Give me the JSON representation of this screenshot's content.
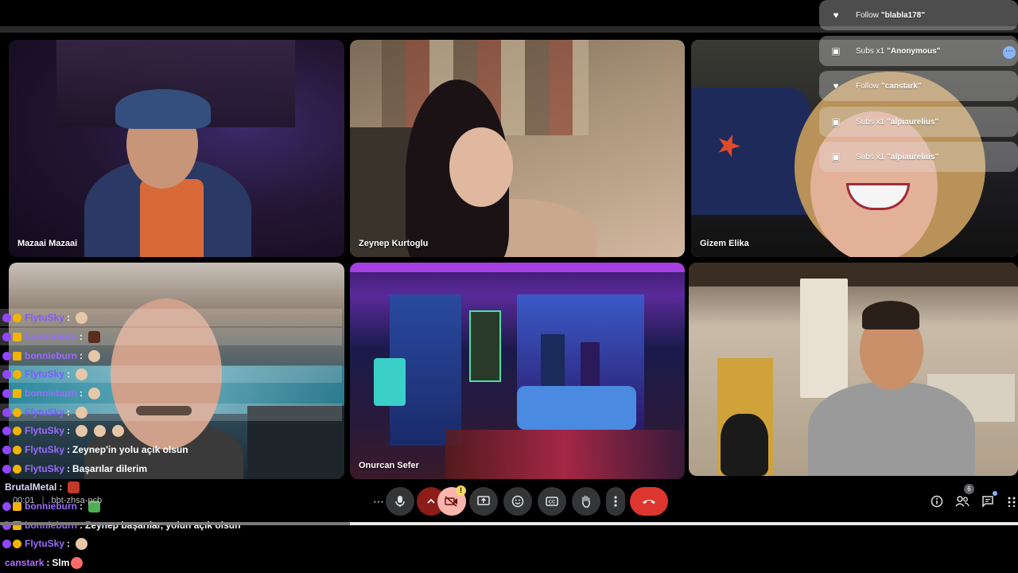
{
  "participants": [
    {
      "name": "Mazaai Mazaai",
      "active": false
    },
    {
      "name": "Zeynep Kurtoglu",
      "active": false
    },
    {
      "name": "Gizem Elika",
      "active": true
    },
    {
      "name": "",
      "active": false
    },
    {
      "name": "Onurcan Sefer",
      "active": false
    },
    {
      "name": "",
      "active": false
    }
  ],
  "alerts": [
    {
      "type": "Follow",
      "icon": "heart-icon",
      "user": "\"blabla178\""
    },
    {
      "type": "Subs x1",
      "icon": "gift-icon",
      "user": "\"Anonymous\""
    },
    {
      "type": "Follow",
      "icon": "heart-icon",
      "user": "\"canstark\""
    },
    {
      "type": "Subs x1",
      "icon": "gift-icon",
      "user": "\"alpiaurelius\""
    },
    {
      "type": "Subs x1",
      "icon": "gift-icon",
      "user": "\"alpiaurelius\""
    }
  ],
  "chat": [
    {
      "user": "FlytuSky",
      "sep": ":",
      "msg": "",
      "emotes": 1
    },
    {
      "user": "bonnieburn",
      "sep": ":",
      "msg": "",
      "emotes": 1
    },
    {
      "user": "bonnieburn",
      "sep": ":",
      "msg": "",
      "emotes": 1
    },
    {
      "user": "FlytuSky",
      "sep": ":",
      "msg": "",
      "emotes": 1
    },
    {
      "user": "bonnieburn",
      "sep": ":",
      "msg": "",
      "emotes": 1
    },
    {
      "user": "FlytuSky",
      "sep": ":",
      "msg": "",
      "emotes": 1
    },
    {
      "user": "FlytuSky",
      "sep": ":",
      "msg": "",
      "emotes": 3
    },
    {
      "user": "FlytuSky",
      "sep": ":",
      "msg": "Zeynep'in yolu açık olsun",
      "emotes": 0
    },
    {
      "user": "FlytuSky",
      "sep": ":",
      "msg": "Başarılar dilerim",
      "emotes": 0
    },
    {
      "user": "BrutalMetal",
      "sep": ":",
      "msg": "",
      "emotes": 1
    },
    {
      "user": "bonnieburn",
      "sep": ":",
      "msg": "",
      "emotes": 1
    },
    {
      "user": "bonnieburn",
      "sep": ":",
      "msg": "Zeynep başarılar, yolun açık olsun",
      "emotes": 0
    },
    {
      "user": "FlytuSky",
      "sep": ":",
      "msg": "",
      "emotes": 1
    },
    {
      "user": "canstark",
      "sep": ":",
      "msg": "Slm",
      "emotes": 1
    }
  ],
  "meeting": {
    "time": "00:01",
    "code": "bbt-zhsa-pcb"
  },
  "controls": {
    "more_options": "⋯",
    "mic": "mic-icon",
    "expand": "chevron-up-icon",
    "camera": "camera-off-icon",
    "camera_warning": "!",
    "present": "present-icon",
    "emoji": "emoji-icon",
    "captions": "captions-icon",
    "raise_hand": "hand-icon",
    "more": "more-vert-icon",
    "hangup": "phone-hangup-icon"
  },
  "right_controls": {
    "info": "info-icon",
    "people": "people-icon",
    "people_count": "6",
    "chat": "chat-icon",
    "activities": "apps-icon"
  },
  "colors": {
    "username": "#9b6bff",
    "hangup": "#dc362e",
    "active_outline": "#a8c7fa",
    "camera_off": "#f9b5b0"
  }
}
